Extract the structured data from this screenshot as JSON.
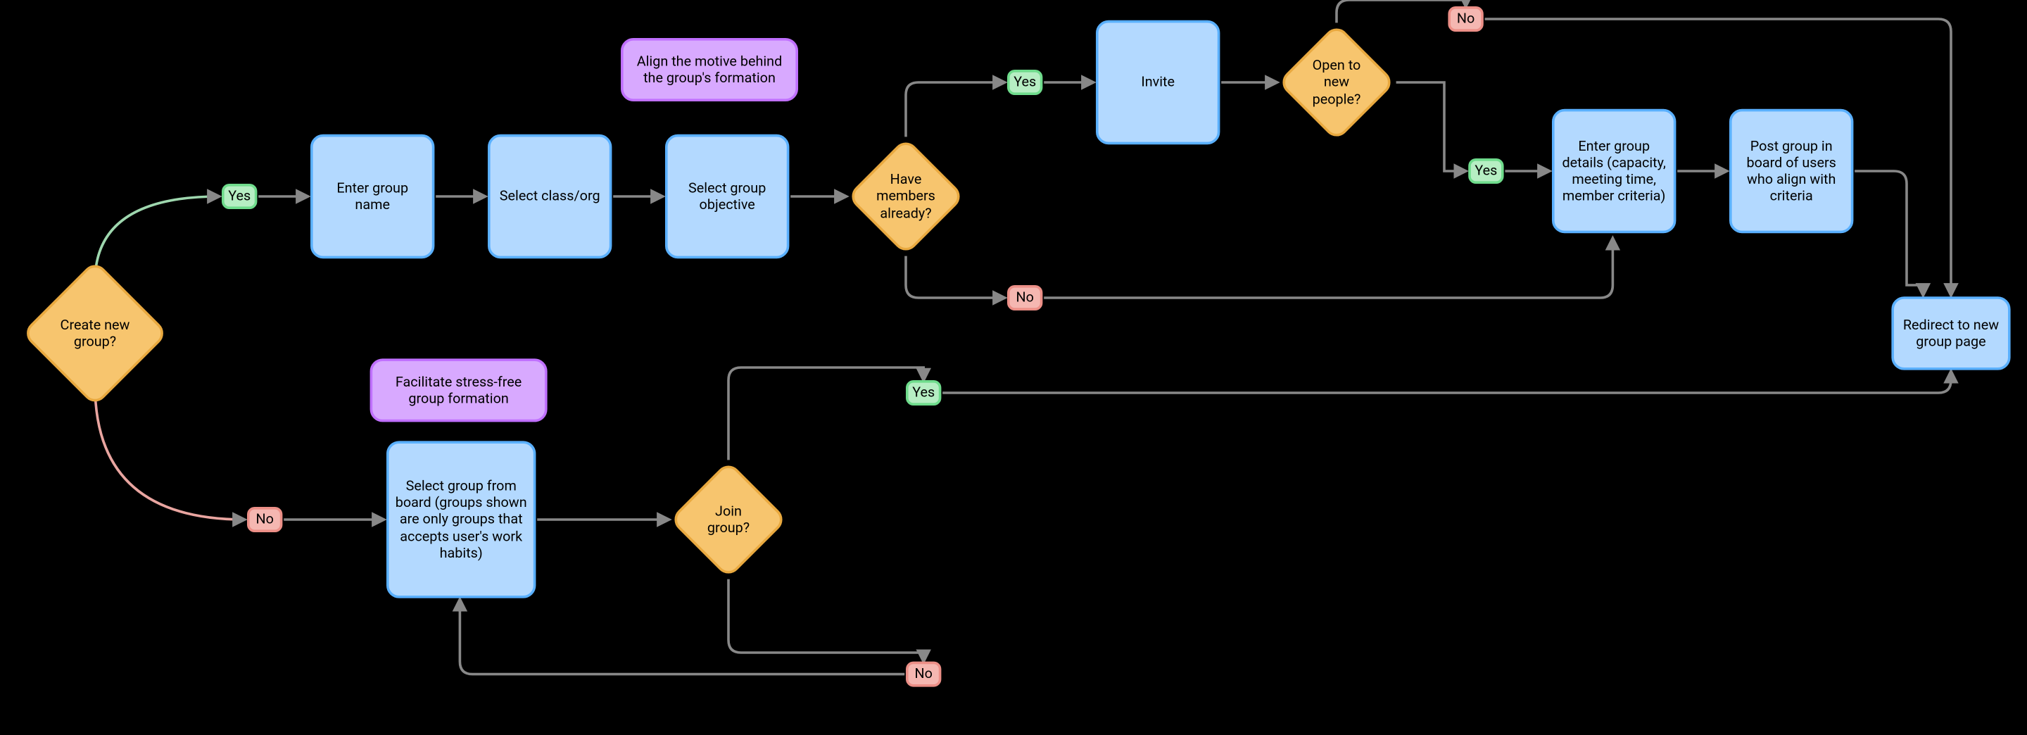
{
  "labels": {
    "yes": "Yes",
    "no": "No"
  },
  "decisions": {
    "create_new_group": "Create new group?",
    "have_members_already": "Have members already?",
    "open_to_new_people": "Open to new people?",
    "join_group": "Join group?"
  },
  "processes": {
    "enter_group_name": "Enter group name",
    "select_class_org": "Select class/org",
    "select_group_objective": "Select group objective",
    "invite": "Invite",
    "enter_group_details": "Enter group details (capacity, meeting time, member criteria)",
    "post_group_board": "Post group in board of users who align with criteria",
    "redirect_new_group_page": "Redirect to new group page",
    "select_group_from_board": "Select group from board (groups shown are only groups that accepts user's work habits)"
  },
  "notes": {
    "align_motive": "Align the motive behind the group's formation",
    "facilitate_stress_free": "Facilitate stress-free group formation"
  }
}
